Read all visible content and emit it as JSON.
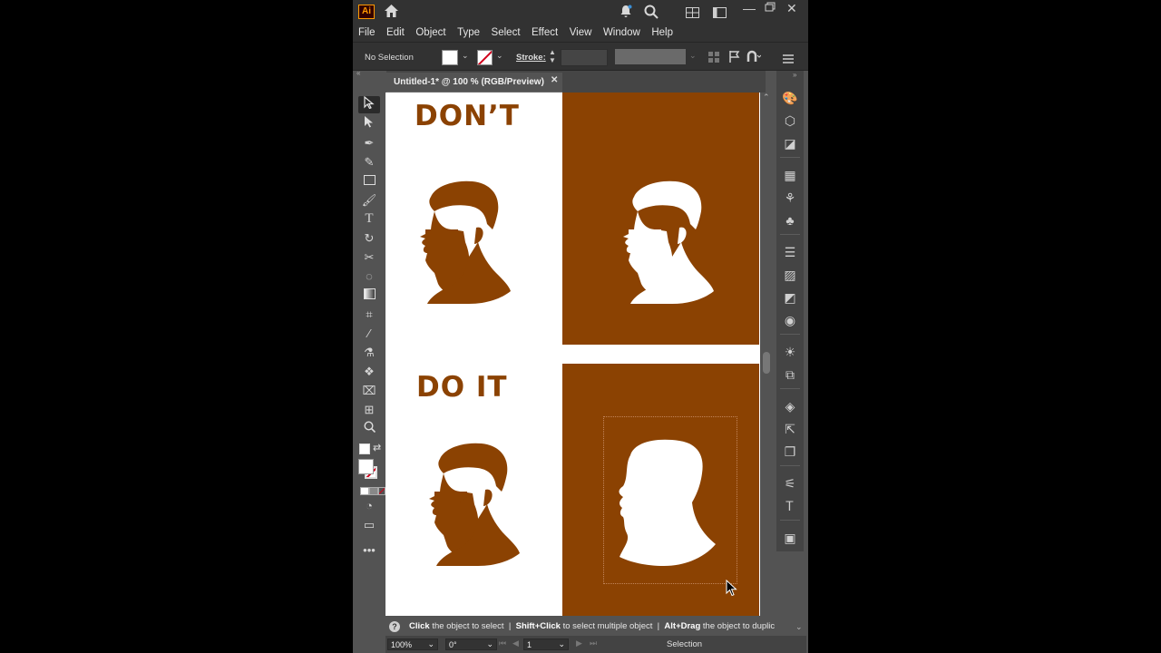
{
  "app": {
    "logo": "Ai"
  },
  "titlebar": {
    "icons": [
      "home-icon",
      "bell-icon",
      "search-icon",
      "arrange-icon",
      "window-icon",
      "minimize-icon",
      "maximize-icon",
      "close-icon"
    ]
  },
  "menu": [
    "File",
    "Edit",
    "Object",
    "Type",
    "Select",
    "Effect",
    "View",
    "Window",
    "Help"
  ],
  "control": {
    "selection_label": "No Selection",
    "stroke_label": "Stroke:"
  },
  "document": {
    "tab_title": "Untitled-1* @ 100 % (RGB/Preview)",
    "close_glyph": "✕"
  },
  "artboard": {
    "dont_text": "DON’T",
    "doit_text": "DO IT",
    "brand_color": "#8b4202"
  },
  "status": {
    "hint_parts": [
      {
        "bold": "Click",
        "text": " the object to select  |  "
      },
      {
        "bold": "Shift+Click",
        "text": " to select multiple object  |  "
      },
      {
        "bold": "Alt+Drag",
        "text": " the object to duplic"
      }
    ],
    "zoom": "100%",
    "rotation": "0°",
    "artboard_num": "1",
    "tool_name": "Selection"
  }
}
